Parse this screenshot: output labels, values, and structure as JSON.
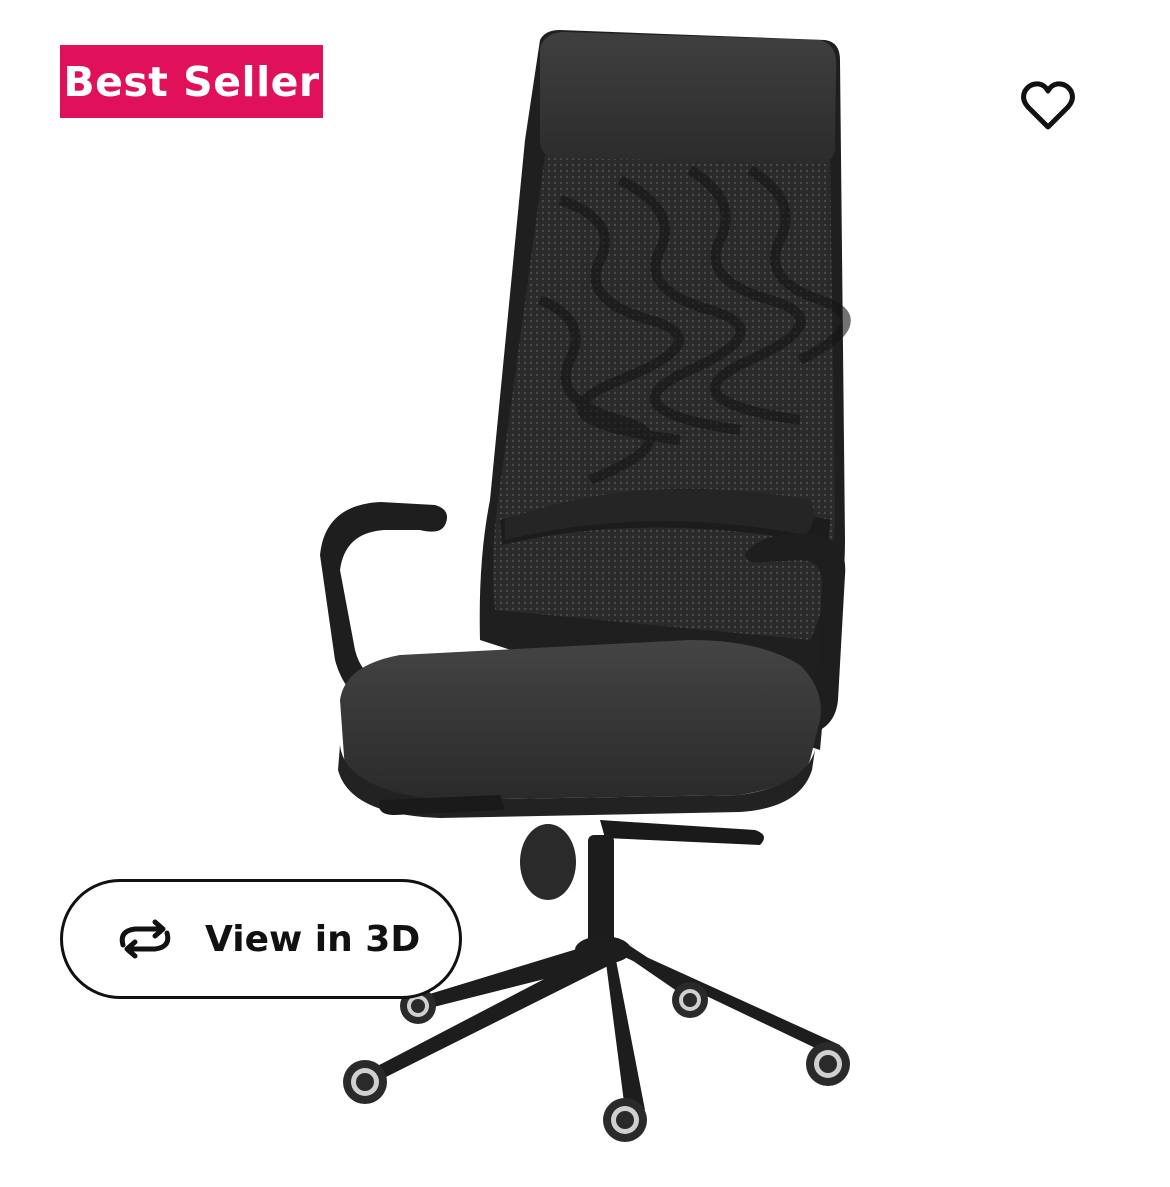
{
  "badge": {
    "label": "Best Seller",
    "color": "#e0105b"
  },
  "wishlist": {
    "icon": "heart-outline-icon"
  },
  "view_3d": {
    "label": "View in 3D",
    "icon": "rotate-3d-icon"
  },
  "product_image": {
    "subject": "office-chair",
    "colors": {
      "fabric": "#3a3a3a",
      "frame": "#1e1e1e",
      "mesh": "#2b2b2b"
    }
  }
}
